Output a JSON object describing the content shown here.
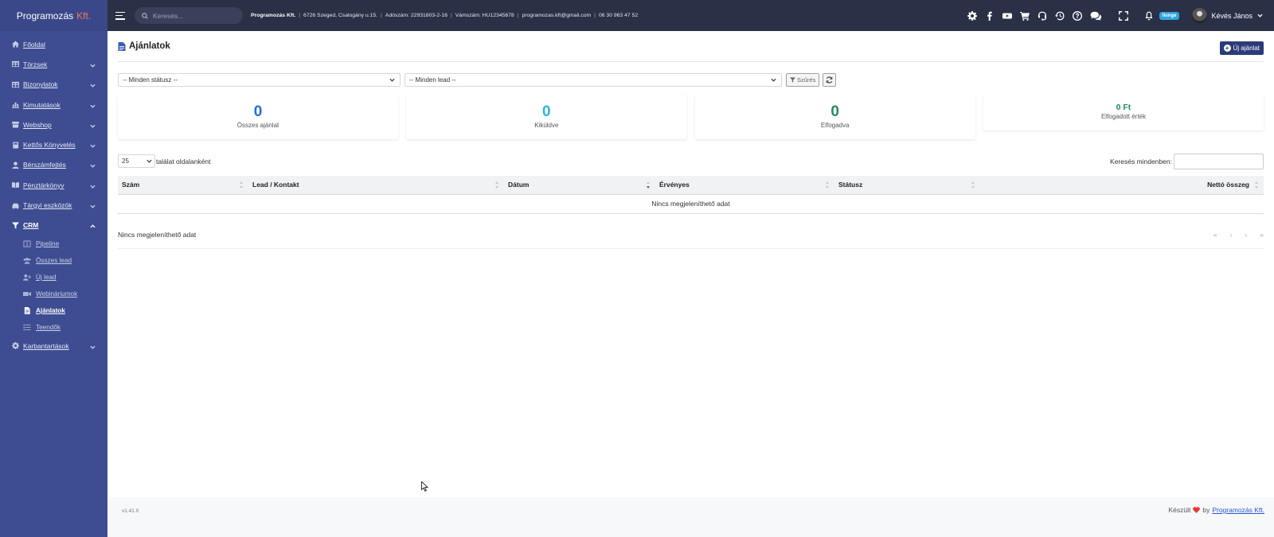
{
  "brand": {
    "name": "Programozás",
    "suffix": "Kft."
  },
  "sidebar": {
    "items": [
      {
        "label": "Főoldal",
        "icon": "home-icon"
      },
      {
        "label": "Törzsek",
        "icon": "table-icon"
      },
      {
        "label": "Bizonylatok",
        "icon": "table-icon"
      },
      {
        "label": "Kimutatások",
        "icon": "chart-icon"
      },
      {
        "label": "Webshop",
        "icon": "store-icon"
      },
      {
        "label": "Kettős Könyvelés",
        "icon": "book-icon"
      },
      {
        "label": "Bérszámfejtés",
        "icon": "user-icon"
      },
      {
        "label": "Pénztárkönyv",
        "icon": "book-open-icon"
      },
      {
        "label": "Tárgyi eszközök",
        "icon": "car-icon"
      },
      {
        "label": "CRM",
        "icon": "funnel-icon"
      },
      {
        "label": "Karbantartások",
        "icon": "gear-icon"
      }
    ],
    "crm_sub": [
      {
        "label": "Pipeline",
        "icon": "columns-icon"
      },
      {
        "label": "Összes lead",
        "icon": "users-icon"
      },
      {
        "label": "Új lead",
        "icon": "user-plus-icon"
      },
      {
        "label": "Webináriumok",
        "icon": "video-icon"
      },
      {
        "label": "Ajánlatok",
        "icon": "file-icon"
      },
      {
        "label": "Teendők",
        "icon": "tasks-icon"
      }
    ]
  },
  "topbar": {
    "search_placeholder": "Keresés...",
    "company": "Programozás Kft.",
    "address": "6726 Szeged, Csalogány u.15.",
    "tax": "Adószám: 22931803-2-16",
    "vat": "Vámszám: HU12345678",
    "email": "programozas.kft@gmail.com",
    "phone": "06 30 963 47 52",
    "badge": "Ilonge",
    "user": "Kévés János"
  },
  "page": {
    "title": "Ajánlatok",
    "new_button": "Új ajánlat",
    "filter_status": "-- Minden státusz --",
    "filter_lead": "-- Minden lead --",
    "filter_button": "Szűrés"
  },
  "stats": [
    {
      "value": "0",
      "label": "Összes ajánlat",
      "color": "#1f6fd6"
    },
    {
      "value": "0",
      "label": "Kiküldve",
      "color": "#2bb6e0"
    },
    {
      "value": "0",
      "label": "Elfogadva",
      "color": "#1f8f5a"
    },
    {
      "value": "0 Ft",
      "label": "Elfogadott érték",
      "color": "#1f8f5a"
    }
  ],
  "table": {
    "page_length": "25",
    "page_length_label": "találat oldalanként",
    "search_label": "Keresés mindenben:",
    "columns": [
      "Szám",
      "Lead / Kontakt",
      "Dátum",
      "Érvényes",
      "Státusz",
      "Nettó összeg"
    ],
    "empty": "Nincs megjeleníthető adat",
    "info": "Nincs megjeleníthető adat",
    "pager": [
      "«",
      "‹",
      "›",
      "»"
    ]
  },
  "footer": {
    "version": "v1.41.0",
    "made": "Készült",
    "by": "by",
    "link": "Programozás Kft."
  }
}
